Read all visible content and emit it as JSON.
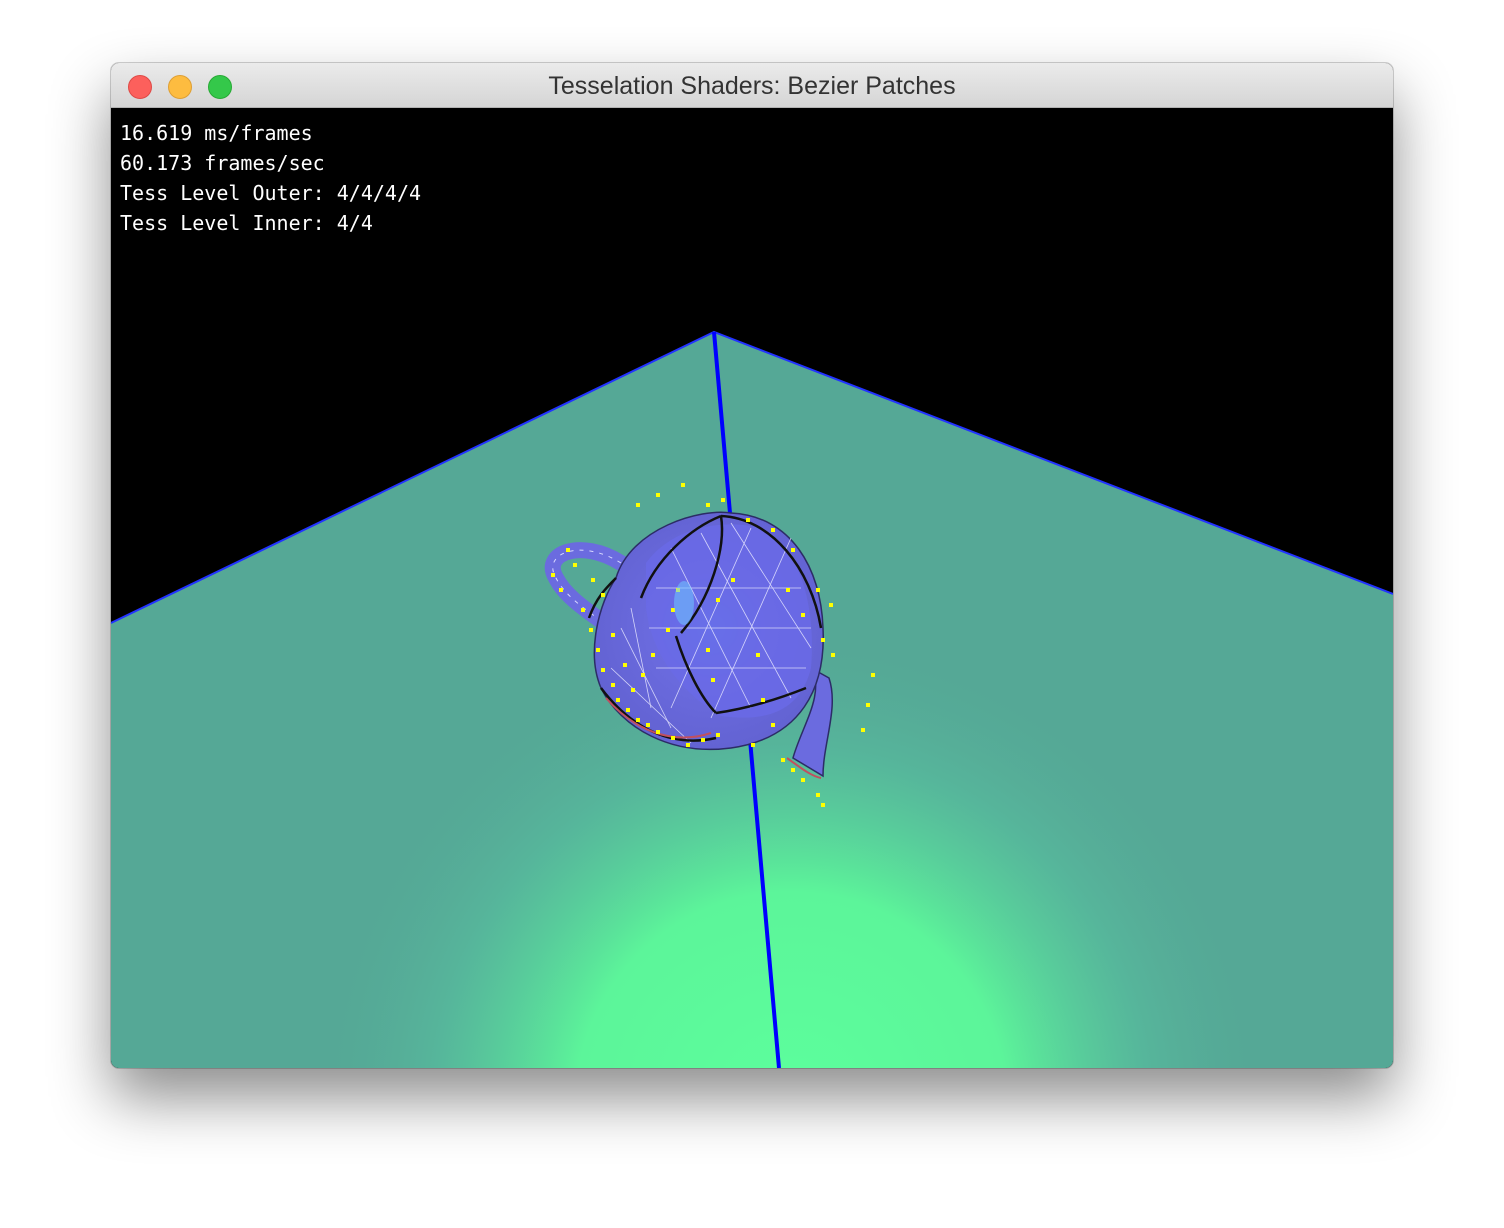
{
  "window": {
    "title": "Tesselation Shaders: Bezier Patches"
  },
  "hud": {
    "ms_per_frame": "16.619 ms/frames",
    "fps": "60.173 frames/sec",
    "tess_outer": "Tess Level Outer: 4/4/4/4",
    "tess_inner": "Tess Level Inner: 4/4"
  },
  "scene": {
    "background_color": "#000000",
    "floor_color": "#55a896",
    "floor_highlight_color": "#5cff9c",
    "axis_color": "#0000ff",
    "teapot_color": "#6b6bdf",
    "control_point_color": "#ffff00"
  }
}
